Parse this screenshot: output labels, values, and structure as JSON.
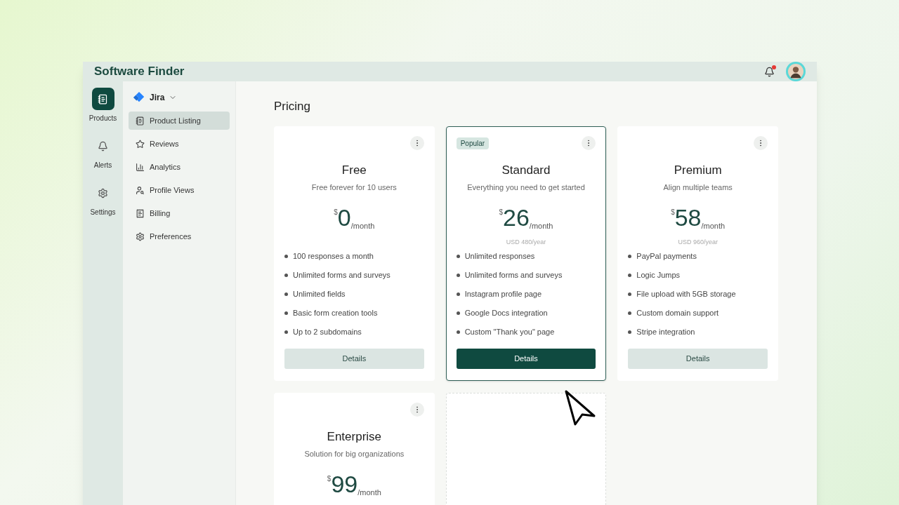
{
  "header": {
    "logo": "Software Finder",
    "notification_unread": true
  },
  "rail": [
    {
      "label": "Products",
      "kind": "listing",
      "selected": true
    },
    {
      "label": "Alerts",
      "kind": "bell",
      "selected": false
    },
    {
      "label": "Settings",
      "kind": "gear",
      "selected": false
    }
  ],
  "product": {
    "name": "Jira"
  },
  "nav": [
    {
      "label": "Product Listing",
      "kind": "listing",
      "selected": true
    },
    {
      "label": "Reviews",
      "kind": "star",
      "selected": false
    },
    {
      "label": "Analytics",
      "kind": "chart",
      "selected": false
    },
    {
      "label": "Profile Views",
      "kind": "profile",
      "selected": false
    },
    {
      "label": "Billing",
      "kind": "billing",
      "selected": false
    },
    {
      "label": "Preferences",
      "kind": "gear",
      "selected": false
    }
  ],
  "page_title": "Pricing",
  "plans": [
    {
      "kind": "plan",
      "name": "Free",
      "description": "Free forever for 10 users",
      "currency": "$",
      "price": "0",
      "period": "/month",
      "features": [
        "100 responses a month",
        "Unlimited forms and surveys",
        "Unlimited fields",
        "Basic form creation tools",
        "Up to 2 subdomains"
      ],
      "button": "Details",
      "highlighted": false
    },
    {
      "kind": "plan",
      "badge": "Popular",
      "name": "Standard",
      "description": "Everything you need to get started",
      "currency": "$",
      "price": "26",
      "period": "/month",
      "yearly": "USD 480/year",
      "features": [
        "Unlimited responses",
        "Unlimited forms and surveys",
        "Instagram profile page",
        "Google Docs integration",
        "Custom \"Thank you\" page"
      ],
      "button": "Details",
      "highlighted": true
    },
    {
      "kind": "plan",
      "name": "Premium",
      "description": "Align multiple teams",
      "currency": "$",
      "price": "58",
      "period": "/month",
      "yearly": "USD 960/year",
      "features": [
        "PayPal payments",
        "Logic Jumps",
        "File upload with 5GB storage",
        "Custom domain support",
        "Stripe integration"
      ],
      "button": "Details",
      "highlighted": false
    },
    {
      "kind": "plan",
      "name": "Enterprise",
      "description": "Solution for big organizations",
      "currency": "$",
      "price": "99",
      "period": "/month",
      "highlighted": false
    },
    {
      "kind": "placeholder"
    }
  ]
}
